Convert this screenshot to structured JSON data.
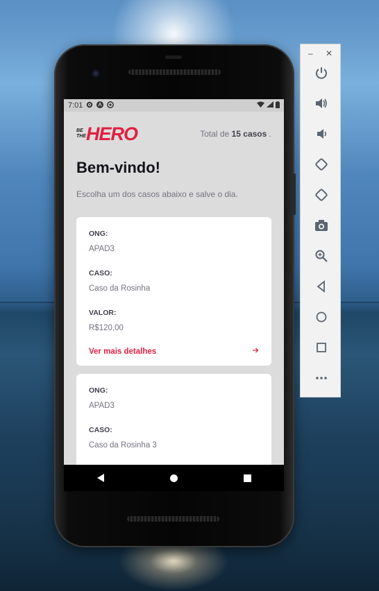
{
  "app": {
    "status_time": "7:01",
    "logo_small": "BE THE",
    "logo_big": "HERO",
    "total_prefix": "Total de",
    "total_count": "15 casos",
    "total_suffix": ".",
    "title": "Bem-vindo!",
    "subtitle": "Escolha um dos casos abaixo e salve o dia.",
    "labels": {
      "ong": "ONG:",
      "case": "CASO:",
      "value": "VALOR:"
    },
    "cases": [
      {
        "ong": "APAD3",
        "case": "Caso da Rosinha",
        "value": "R$120,00",
        "details": "Ver mais detalhes"
      },
      {
        "ong": "APAD3",
        "case": "Caso da Rosinha 3"
      }
    ],
    "accent_color": "#e02041"
  },
  "toolbar": {
    "minimize": "–",
    "close": "✕",
    "buttons": [
      "power-icon",
      "volume-up-icon",
      "volume-down-icon",
      "rotate-left-icon",
      "rotate-right-icon",
      "camera-icon",
      "zoom-icon",
      "back-icon",
      "home-icon",
      "overview-icon",
      "more-icon"
    ]
  }
}
